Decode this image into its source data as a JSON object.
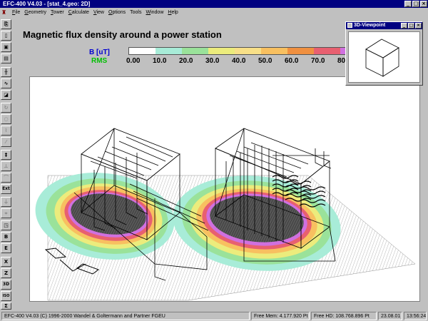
{
  "window": {
    "title": "EFC-400 V4.03 - [stat_4.geo: 2D]"
  },
  "menu": [
    {
      "key": "F",
      "rest": "ile"
    },
    {
      "key": "G",
      "rest": "eometry"
    },
    {
      "key": "T",
      "rest": "ower"
    },
    {
      "key": "C",
      "rest": "alculate"
    },
    {
      "key": "V",
      "rest": "iew"
    },
    {
      "key": "O",
      "rest": "ptions"
    },
    {
      "key": "",
      "rest": "Tools"
    },
    {
      "key": "W",
      "rest": "indow"
    },
    {
      "key": "H",
      "rest": "elp"
    }
  ],
  "toolbar": {
    "b_label": "B",
    "e_label": "E",
    "ext_label": "Ext",
    "x_label": "X",
    "z_label": "Z",
    "threed_label": "3D",
    "iso_label": "ISO",
    "sigma_label": "Σ"
  },
  "document": {
    "title": "Magnetic flux density around a power station",
    "legend_unit": "B [uT]",
    "legend_mode": "RMS",
    "scale_colors": [
      "#ffffff",
      "#a8ecd8",
      "#9ae29a",
      "#ecec7c",
      "#f8e088",
      "#f8c060",
      "#f09040",
      "#e86070",
      "#d070e0"
    ],
    "scale_ticks": [
      "0.00",
      "10.0",
      "20.0",
      "30.0",
      "40.0",
      "50.0",
      "60.0",
      "70.0",
      "80."
    ]
  },
  "viewpoint": {
    "title": "3D-Viewpoint"
  },
  "status": {
    "app": "EFC-400  V4.03  (C) 1996-2000  Wandel & Goltermann and Partner FGEU",
    "free_mem": "Free Mem:   4.177.920 Pt",
    "free_hd": "Free HD: 108.768.896 Pt",
    "date": "23.08.01",
    "time": "13:56:24"
  }
}
